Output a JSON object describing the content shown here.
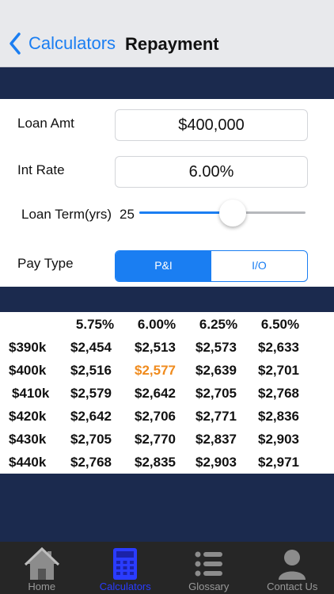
{
  "nav": {
    "back_label": "Calculators",
    "title": "Repayment"
  },
  "form": {
    "loan_amt": {
      "label": "Loan Amt",
      "value": "$400,000"
    },
    "int_rate": {
      "label": "Int Rate",
      "value": "6.00%"
    },
    "loan_term": {
      "label": "Loan Term(yrs)",
      "value": "25",
      "slider_fraction": 0.56
    },
    "pay_type": {
      "label": "Pay Type",
      "options": [
        "P&I",
        "I/O"
      ],
      "selected": "P&I"
    }
  },
  "table": {
    "rates": [
      "5.75%",
      "6.00%",
      "6.25%",
      "6.50%"
    ],
    "rows": [
      {
        "amount": "$390k",
        "values": [
          "$2,454",
          "$2,513",
          "$2,573",
          "$2,633"
        ]
      },
      {
        "amount": "$400k",
        "values": [
          "$2,516",
          "$2,577",
          "$2,639",
          "$2,701"
        ]
      },
      {
        "amount": "$410k",
        "values": [
          "$2,579",
          "$2,642",
          "$2,705",
          "$2,768"
        ]
      },
      {
        "amount": "$420k",
        "values": [
          "$2,642",
          "$2,706",
          "$2,771",
          "$2,836"
        ]
      },
      {
        "amount": "$430k",
        "values": [
          "$2,705",
          "$2,770",
          "$2,837",
          "$2,903"
        ]
      },
      {
        "amount": "$440k",
        "values": [
          "$2,768",
          "$2,835",
          "$2,903",
          "$2,971"
        ]
      }
    ],
    "highlight": {
      "row": 1,
      "col": 1,
      "color": "#f08b1d"
    }
  },
  "tabs": [
    {
      "label": "Home",
      "icon": "home-icon",
      "active": false
    },
    {
      "label": "Calculators",
      "icon": "calculator-icon",
      "active": true
    },
    {
      "label": "Glossary",
      "icon": "list-icon",
      "active": false
    },
    {
      "label": "Contact Us",
      "icon": "person-icon",
      "active": false
    }
  ],
  "colors": {
    "accent": "#1a7ef2",
    "navy": "#1b2a4e",
    "highlight": "#f08b1d",
    "tab_active": "#2a3cff"
  }
}
